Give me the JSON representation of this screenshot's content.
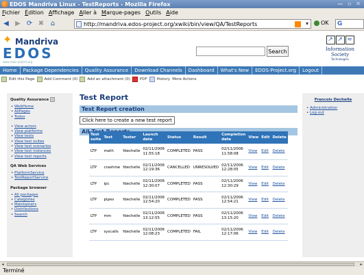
{
  "window": {
    "title": "EDOS Mandriva Linux - TestReports - Mozilla Firefox"
  },
  "menubar": [
    "Fichier",
    "Édition",
    "Affichage",
    "Aller à",
    "Marque-pages",
    "Outils",
    "Aide"
  ],
  "navbar": {
    "url": "http://mandriva.edos-project.org/xwiki/bin/view/QA/TestReports",
    "go_label": "OK",
    "search_engine": "G"
  },
  "header": {
    "logo_mandriva": "Mandriva",
    "logo_edos": "EDOS",
    "logo_sub": "www.edos-project.org",
    "search_button": "Search",
    "infosoc_title": "Information Society",
    "infosoc_sub": "Technologies"
  },
  "mainnav": [
    "Home",
    "Package Dependencies",
    "Quality Assurance",
    "Download Channels",
    "Dashboard",
    "What's New",
    "EDOS-Project.org",
    "Logout"
  ],
  "editbar": [
    "Edit this Page",
    "Add Comment (0)",
    "Add an attachment (0)",
    "PDF",
    "History",
    "More Actions"
  ],
  "leftbar": {
    "qa_title": "Quality Assurance",
    "qa_links": [
      "WebHome",
      "AllPages",
      "Todos"
    ],
    "view_links": [
      "View actors",
      "View platforms",
      "View tests",
      "View test suites",
      "View test scenarios",
      "View test instances",
      "View test reports"
    ],
    "ws_title": "QA Web Services",
    "ws_links": [
      "PlatformService",
      "TestReportService"
    ],
    "pb_title": "Package browser",
    "pb_links": [
      "All packages",
      "Categories",
      "Maintainers",
      "Distributions",
      "Search"
    ]
  },
  "main": {
    "title": "Test Report",
    "creation_header": "Test Report creation",
    "create_link": "Click here to create a new test report",
    "all_header": "All Test Reports"
  },
  "table": {
    "headers": [
      "Test suite",
      "Test",
      "Tester",
      "Launch date",
      "Status",
      "Result",
      "Completion date",
      "View",
      "Edit",
      "Delete"
    ],
    "rows": [
      {
        "suite": "LTP",
        "test": "math",
        "tester": "fdechelle",
        "launch": "02/11/2006 11:55:18",
        "status": "COMPLETED",
        "result": "PASS",
        "completion": "02/11/2006 11:58:08",
        "view": "View",
        "edit": "Edit",
        "delete": "Delete"
      },
      {
        "suite": "LTP",
        "test": "crashme",
        "tester": "fdechelle",
        "launch": "02/11/2006 12:19:36",
        "status": "CANCELLED",
        "result": "UNRESOLVED",
        "completion": "02/11/2006 12:28:05",
        "view": "View",
        "edit": "Edit",
        "delete": "Delete"
      },
      {
        "suite": "LTP",
        "test": "ipc",
        "tester": "fdechelle",
        "launch": "02/11/2006 12:30:07",
        "status": "COMPLETED",
        "result": "PASS",
        "completion": "02/11/2006 12:30:29",
        "view": "View",
        "edit": "Edit",
        "delete": "Delete"
      },
      {
        "suite": "LTP",
        "test": "pipes",
        "tester": "fdechelle",
        "launch": "02/11/2006 12:54:20",
        "status": "COMPLETED",
        "result": "PASS",
        "completion": "02/11/2006 12:54:21",
        "view": "View",
        "edit": "Edit",
        "delete": "Delete"
      },
      {
        "suite": "LTP",
        "test": "mm",
        "tester": "fdechelle",
        "launch": "02/11/2006 13:12:55",
        "status": "COMPLETED",
        "result": "PASS",
        "completion": "02/11/2006 13:15:20",
        "view": "View",
        "edit": "Edit",
        "delete": "Delete"
      },
      {
        "suite": "LTP",
        "test": "syscalls",
        "tester": "fdechelle",
        "launch": "02/11/2006 12:08:23",
        "status": "COMPLETED",
        "result": "FAIL",
        "completion": "02/11/2006 12:17:06",
        "view": "View",
        "edit": "Edit",
        "delete": "Delete"
      }
    ]
  },
  "rightbar": {
    "user": "Francois Dechelle",
    "links": [
      "Administration",
      "Log-out"
    ]
  },
  "statusbar": {
    "text": "Terminé"
  }
}
